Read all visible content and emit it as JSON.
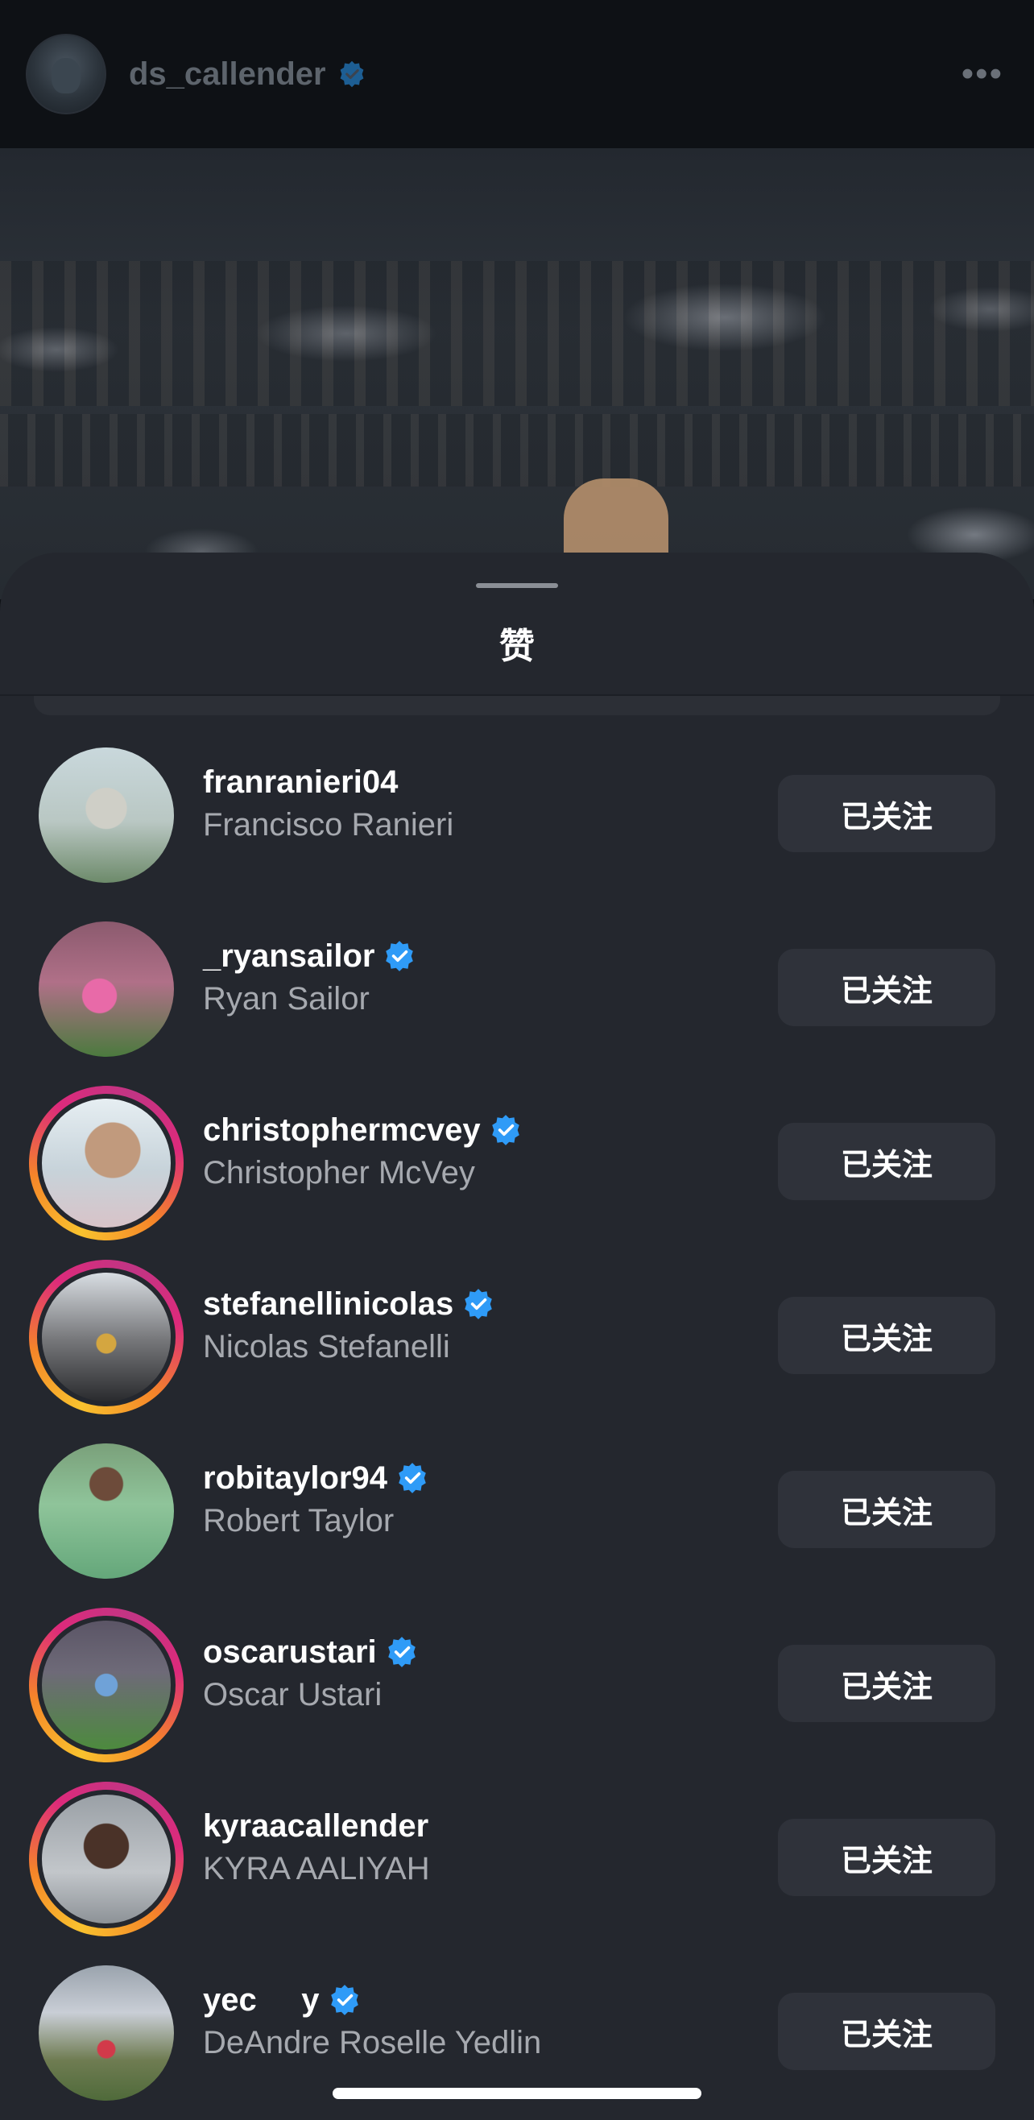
{
  "post": {
    "username": "ds_callender",
    "more_icon": "ellipsis-icon"
  },
  "sheet": {
    "title": "赞"
  },
  "colors": {
    "sheet_bg": "#24272e",
    "button_bg": "#2f323a",
    "verified_blue": "#2f9bf7",
    "secondary_text": "#a6a9af"
  },
  "users": [
    {
      "username": "franranieri04",
      "fullname": "Francisco Ranieri",
      "verified": false,
      "story_ring": false,
      "button": "已关注"
    },
    {
      "username": "_ryansailor",
      "fullname": "Ryan Sailor",
      "verified": true,
      "story_ring": false,
      "button": "已关注"
    },
    {
      "username": "christophermcvey",
      "fullname": "Christopher McVey",
      "verified": true,
      "story_ring": true,
      "button": "已关注"
    },
    {
      "username": "stefanellinicolas",
      "fullname": "Nicolas Stefanelli",
      "verified": true,
      "story_ring": true,
      "button": "已关注"
    },
    {
      "username": "robitaylor94",
      "fullname": "Robert Taylor",
      "verified": true,
      "story_ring": false,
      "button": "已关注"
    },
    {
      "username": "oscarustari",
      "fullname": "Oscar Ustari",
      "verified": true,
      "story_ring": true,
      "button": "已关注"
    },
    {
      "username": "kyraacallender",
      "fullname": "KYRA AALIYAH",
      "verified": false,
      "story_ring": true,
      "button": "已关注"
    },
    {
      "username": "yec     y",
      "fullname": "DeAndre Roselle Yedlin",
      "verified": true,
      "story_ring": false,
      "button": "已关注"
    }
  ]
}
